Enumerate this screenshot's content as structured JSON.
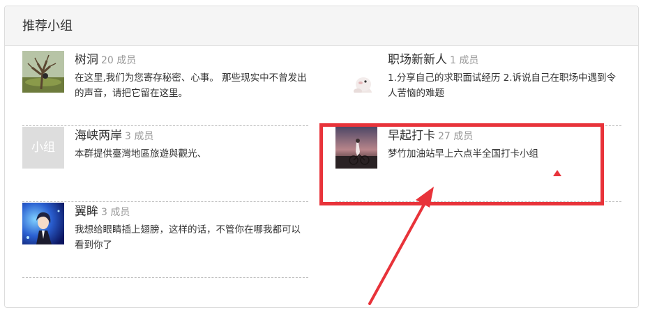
{
  "panel": {
    "title": "推荐小组"
  },
  "groups": [
    {
      "name": "树洞",
      "members": "20 成员",
      "desc": "在这里,我们为您寄存秘密、心事。 那些现实中不曾发出的声音，请把它留在这里。",
      "avatar": "tree-painting-image"
    },
    {
      "name": "职场新新人",
      "members": "1 成员",
      "desc": "1.分享自己的求职面试经历 2.诉说自己在职场中遇到令人苦恼的难题",
      "avatar": "plush-toy-image"
    },
    {
      "name": "海峡两岸",
      "members": "3 成员",
      "desc": "本群提供臺灣地區旅遊與觀光、",
      "avatar_text": "小组"
    },
    {
      "name": "早起打卡",
      "members": "27 成员",
      "desc": "梦竹加油站早上六点半全国打卡小组",
      "avatar": "sunrise-cyclist-image"
    },
    {
      "name": "翼眸",
      "members": "3 成员",
      "desc": "我想给眼睛插上翅膀，这样的话，不管你在哪我都可以看到你了",
      "avatar": "anime-character-image"
    }
  ],
  "annotation": {
    "color": "#e8333a"
  }
}
